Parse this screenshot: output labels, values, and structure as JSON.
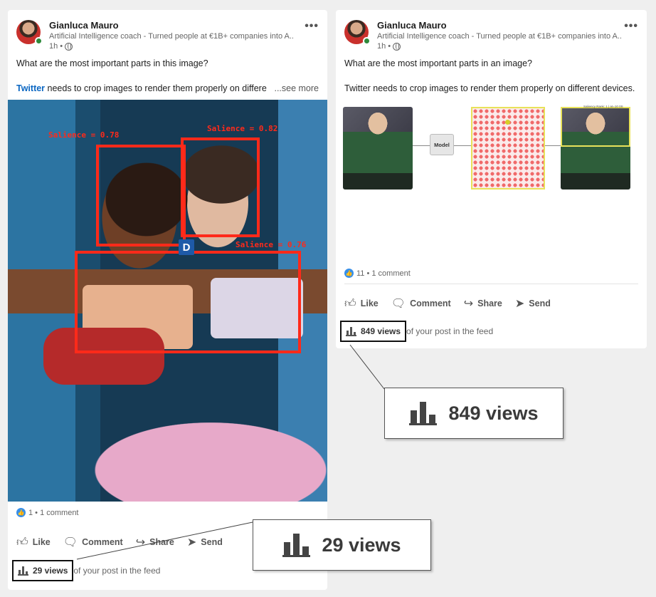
{
  "left_post": {
    "author": "Gianluca Mauro",
    "headline": "Artificial Intelligence coach - Turned people at €1B+ companies into A...",
    "time": "1h •",
    "menu": "•••",
    "text_line1": "What are the most important parts in this image?",
    "text_line2_link": "Twitter",
    "text_line2_rest": " needs to crop images to render them properly on differe",
    "see_more": "...see more",
    "saliences": [
      "Salience = 0.78",
      "Salience = 0.82",
      "Salience = 0.76"
    ],
    "badge": "D",
    "reactions": "1 • 1 comment",
    "actions": {
      "like": "Like",
      "comment": "Comment",
      "share": "Share",
      "send": "Send"
    },
    "views": "29 views",
    "views_suffix": " of your post in the feed"
  },
  "right_post": {
    "author": "Gianluca Mauro",
    "headline": "Artificial Intelligence coach - Turned people at €1B+ companies into A...",
    "time": "1h •",
    "menu": "•••",
    "text_line1": "What are the most important parts in an image?",
    "text_line2": "Twitter needs to crop images to render them properly on different devices.",
    "model_label": "Model",
    "saliency_caption": "Saliency Rank: 1 | at=10 0S",
    "reactions": "11 • 1 comment",
    "actions": {
      "like": "Like",
      "comment": "Comment",
      "share": "Share",
      "send": "Send"
    },
    "views": "849 views",
    "views_suffix": " of your post in the feed"
  },
  "callouts": {
    "right": "849 views",
    "left": "29 views"
  },
  "icons": [
    "globe-icon",
    "like-icon",
    "comment-icon",
    "share-icon",
    "send-icon",
    "bar-chart-icon",
    "more-icon"
  ],
  "colors": {
    "link": "#0a66c2",
    "salience": "#ff2a1a",
    "badge": "#1e5aa8",
    "online": "#2e8a3b"
  }
}
